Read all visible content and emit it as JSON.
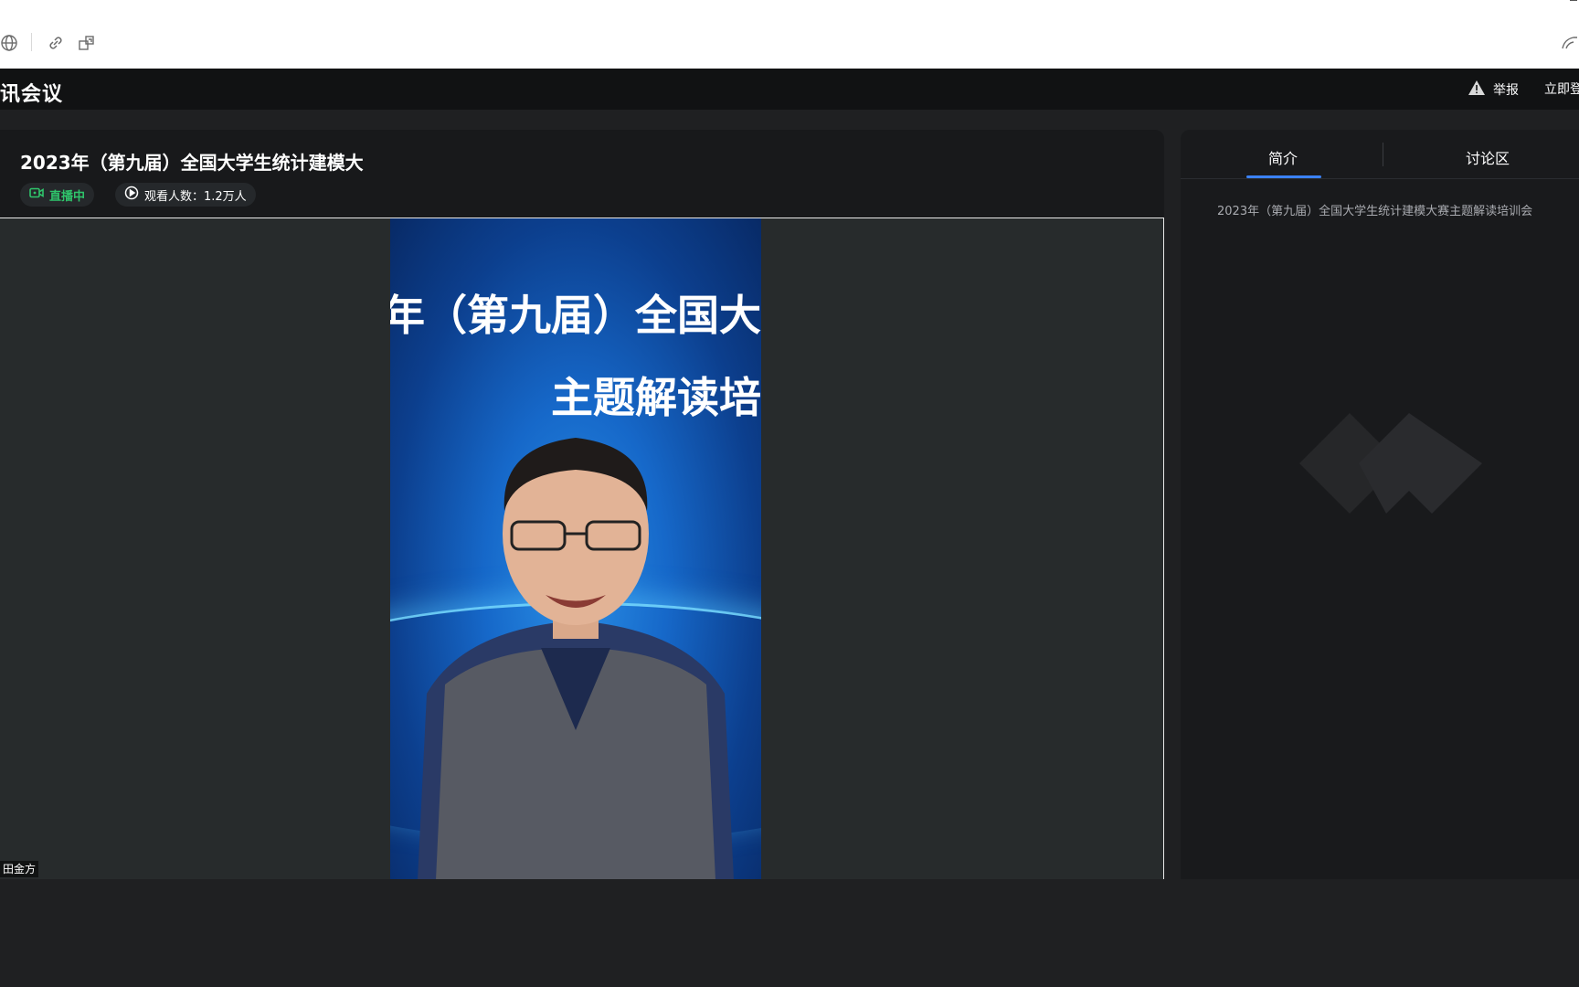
{
  "browser": {
    "icons": [
      "globe-icon",
      "link-icon",
      "share-window-icon"
    ]
  },
  "header": {
    "app_title": "讯会议",
    "report_label": "举报",
    "login_label": "立即登"
  },
  "event": {
    "title": "2023年（第九届）全国大学生统计建模大",
    "live_label": "直播中",
    "viewers_label": "观看人数：1.2万人"
  },
  "video": {
    "slide_line1": "年（第九届）全国大",
    "slide_line2": "主题解读培",
    "speaker_name": "田金方"
  },
  "side_panel": {
    "tabs": [
      {
        "label": "简介",
        "active": true
      },
      {
        "label": "讨论区",
        "active": false
      }
    ],
    "intro_text": "2023年（第九届）全国大学生统计建模大赛主题解读培训会"
  },
  "colors": {
    "live_green": "#2fc46b",
    "tab_accent": "#3b82f6",
    "panel_bg": "#18191b"
  }
}
